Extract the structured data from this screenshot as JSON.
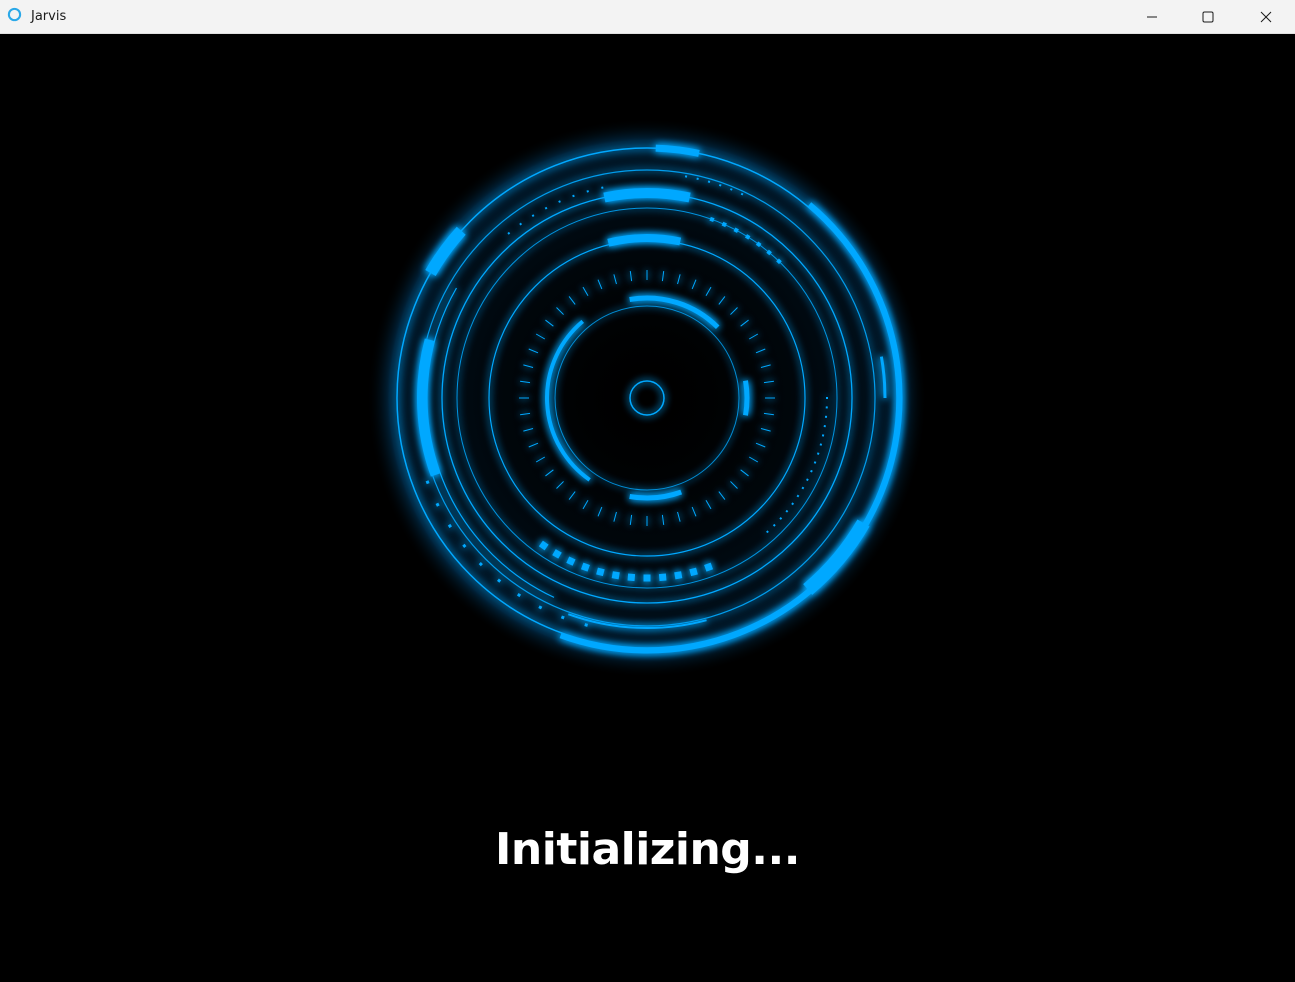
{
  "window": {
    "title": "Jarvis",
    "controls": {
      "minimize": "minimize",
      "maximize": "maximize",
      "close": "close"
    },
    "icon": "app-ring-icon"
  },
  "main": {
    "status_text": "Initializing...",
    "hud_graphic": "arc-reactor-loading-rings"
  },
  "colors": {
    "accent": "#00a8ff",
    "glow": "#0090ff",
    "background": "#000000",
    "titlebar": "#f3f3f3",
    "text": "#ffffff"
  }
}
